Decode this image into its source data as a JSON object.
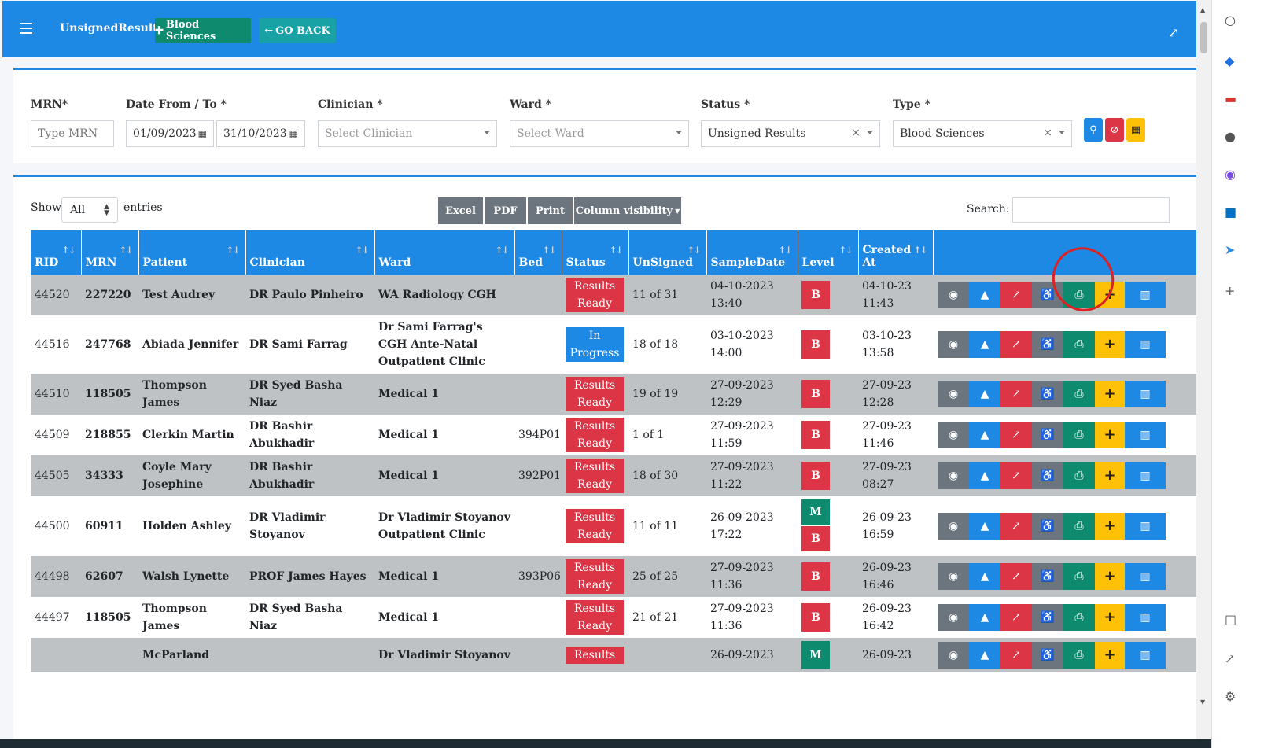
{
  "header": {
    "title": "UnsignedResults",
    "blood_btn": "Blood Sciences",
    "back_btn": "GO BACK"
  },
  "filters": {
    "mrn_label": "MRN*",
    "mrn_placeholder": "Type MRN",
    "date_label": "Date From / To *",
    "date_from": "01/09/2023",
    "date_to": "31/10/2023",
    "clinician_label": "Clinician *",
    "clinician_placeholder": "Select Clinician",
    "ward_label": "Ward *",
    "ward_placeholder": "Select Ward",
    "status_label": "Status *",
    "status_value": "Unsigned Results",
    "type_label": "Type *",
    "type_value": "Blood Sciences"
  },
  "table_controls": {
    "show": "Show",
    "show_value": "All",
    "entries": "entries",
    "excel": "Excel",
    "pdf": "PDF",
    "print": "Print",
    "column_visibility": "Column visibility",
    "search": "Search:"
  },
  "columns": [
    "RID",
    "MRN",
    "Patient",
    "Clinician",
    "Ward",
    "Bed",
    "Status",
    "UnSigned",
    "SampleDate",
    "Level",
    "Created At",
    ""
  ],
  "rows": [
    {
      "rid": "44520",
      "mrn": "227220",
      "patient": "Test Audrey",
      "clinician": "DR Paulo Pinheiro",
      "ward": "WA Radiology CGH",
      "bed": "",
      "status": "Results Ready",
      "unsigned": "11 of 31",
      "sample": "04-10-2023 13:40",
      "levels": [
        "B"
      ],
      "created": "04-10-23 11:43"
    },
    {
      "rid": "44516",
      "mrn": "247768",
      "patient": "Abiada Jennifer",
      "clinician": "DR Sami Farrag",
      "ward": "Dr Sami Farrag's CGH Ante-Natal Outpatient Clinic",
      "bed": "",
      "status": "In Progress",
      "unsigned": "18 of 18",
      "sample": "03-10-2023 14:00",
      "levels": [
        "B"
      ],
      "created": "03-10-23 13:58"
    },
    {
      "rid": "44510",
      "mrn": "118505",
      "patient": "Thompson James",
      "clinician": "DR Syed Basha Niaz",
      "ward": "Medical 1",
      "bed": "",
      "status": "Results Ready",
      "unsigned": "19 of 19",
      "sample": "27-09-2023 12:29",
      "levels": [
        "B"
      ],
      "created": "27-09-23 12:28"
    },
    {
      "rid": "44509",
      "mrn": "218855",
      "patient": "Clerkin Martin",
      "clinician": "DR Bashir Abukhadir",
      "ward": "Medical 1",
      "bed": "394P01",
      "status": "Results Ready",
      "unsigned": "1 of 1",
      "sample": "27-09-2023 11:59",
      "levels": [
        "B"
      ],
      "created": "27-09-23 11:46"
    },
    {
      "rid": "44505",
      "mrn": "34333",
      "patient": "Coyle Mary Josephine",
      "clinician": "DR Bashir Abukhadir",
      "ward": "Medical 1",
      "bed": "392P01",
      "status": "Results Ready",
      "unsigned": "18 of 30",
      "sample": "27-09-2023 11:22",
      "levels": [
        "B"
      ],
      "created": "27-09-23 08:27"
    },
    {
      "rid": "44500",
      "mrn": "60911",
      "patient": "Holden Ashley",
      "clinician": "DR Vladimir Stoyanov",
      "ward": "Dr Vladimir Stoyanov Outpatient Clinic",
      "bed": "",
      "status": "Results Ready",
      "unsigned": "11 of 11",
      "sample": "26-09-2023 17:22",
      "levels": [
        "M",
        "B"
      ],
      "created": "26-09-23 16:59"
    },
    {
      "rid": "44498",
      "mrn": "62607",
      "patient": "Walsh Lynette",
      "clinician": "PROF James Hayes",
      "ward": "Medical 1",
      "bed": "393P06",
      "status": "Results Ready",
      "unsigned": "25 of 25",
      "sample": "27-09-2023 11:36",
      "levels": [
        "B"
      ],
      "created": "26-09-23 16:46"
    },
    {
      "rid": "44497",
      "mrn": "118505",
      "patient": "Thompson James",
      "clinician": "DR Syed Basha Niaz",
      "ward": "Medical 1",
      "bed": "",
      "status": "Results Ready",
      "unsigned": "21 of 21",
      "sample": "27-09-2023 11:36",
      "levels": [
        "B"
      ],
      "created": "26-09-23 16:42"
    },
    {
      "rid": "",
      "mrn": "",
      "patient": "McParland",
      "clinician": "",
      "ward": "Dr Vladimir Stoyanov",
      "bed": "",
      "status": "Results",
      "unsigned": "",
      "sample": "26-09-2023",
      "levels": [
        "M"
      ],
      "created": "26-09-23"
    }
  ]
}
